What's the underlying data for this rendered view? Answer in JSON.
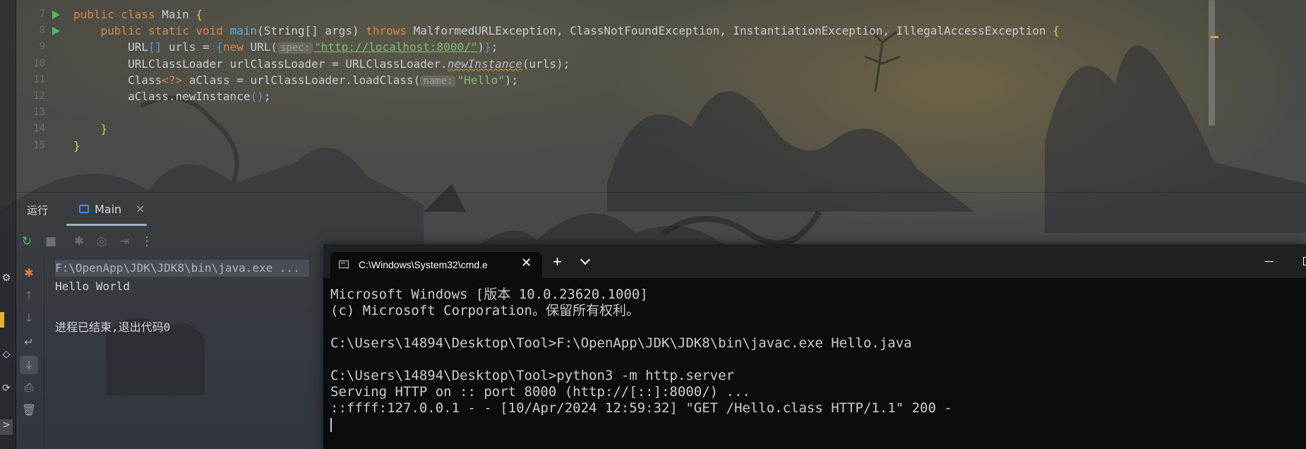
{
  "editor": {
    "lines": [
      {
        "num": "7",
        "run": true,
        "parts": [
          [
            "kw",
            "public class "
          ],
          [
            "br",
            "Main "
          ],
          [
            "br2",
            "{"
          ]
        ]
      },
      {
        "num": "8",
        "run": true,
        "parts": [
          [
            "kw",
            "    public static void "
          ],
          [
            "fn",
            "main"
          ],
          [
            "br",
            "(String[] args) "
          ],
          [
            "kw",
            "throws "
          ],
          [
            "br",
            "MalformedURLException, ClassNotFoundException, InstantiationException, IllegalAccessException "
          ],
          [
            "br2",
            "{"
          ]
        ]
      },
      {
        "num": "9",
        "run": false,
        "parts": [
          [
            "br",
            "        URL"
          ],
          [
            "br3",
            "[]"
          ],
          [
            "br",
            " urls = "
          ],
          [
            "br3",
            "{"
          ],
          [
            "kw",
            "new "
          ],
          [
            "br",
            "URL("
          ],
          [
            "hint",
            "spec:"
          ],
          [
            "str-link",
            "\"http://localhost:8000/\""
          ],
          [
            "br",
            ")"
          ],
          [
            "br3",
            "}"
          ],
          [
            "br",
            ";"
          ]
        ]
      },
      {
        "num": "10",
        "run": false,
        "parts": [
          [
            "br",
            "        URLClassLoader urlClassLoader = URLClassLoader."
          ],
          [
            "it",
            "newInstance"
          ],
          [
            "br",
            "(urls);"
          ]
        ]
      },
      {
        "num": "11",
        "run": false,
        "parts": [
          [
            "br",
            "        Class"
          ],
          [
            "kw",
            "<?>"
          ],
          [
            "br",
            " aClass = urlClassLoader.loadClass("
          ],
          [
            "hint",
            "name:"
          ],
          [
            "str",
            "\"Hello\""
          ],
          [
            "br",
            ");"
          ]
        ]
      },
      {
        "num": "12",
        "run": false,
        "parts": [
          [
            "br",
            "        aClass.newInstance"
          ],
          [
            "br3",
            "()"
          ],
          [
            "br",
            ";"
          ]
        ]
      },
      {
        "num": "13",
        "run": false,
        "parts": []
      },
      {
        "num": "14",
        "run": false,
        "parts": [
          [
            "br2",
            "    }"
          ]
        ]
      },
      {
        "num": "15",
        "run": false,
        "parts": [
          [
            "br2",
            "}"
          ]
        ]
      }
    ]
  },
  "run_panel": {
    "label": "运行",
    "tab_title": "Main",
    "tab_close": "×",
    "console": {
      "command": "F:\\OpenApp\\JDK\\JDK8\\bin\\java.exe ...",
      "output": "Hello World",
      "exit": "进程已结束,退出代码0"
    }
  },
  "icons": {
    "rerun": "↻",
    "stop": "■",
    "debug": "✱",
    "camera": "◎",
    "exit": "⇥",
    "more": "⋮",
    "up": "↑",
    "down": "↓",
    "wrap": "↵",
    "scroll_end": "⤓",
    "print": "⎙",
    "trash": "🗑"
  },
  "cmd": {
    "tab_title": "C:\\Windows\\System32\\cmd.e",
    "tab_close": "✕",
    "new_tab": "+",
    "lines": [
      "Microsoft Windows [版本 10.0.23620.1000]",
      "(c) Microsoft Corporation。保留所有权利。",
      "",
      "C:\\Users\\14894\\Desktop\\Tool>F:\\OpenApp\\JDK\\JDK8\\bin\\javac.exe Hello.java",
      "",
      "C:\\Users\\14894\\Desktop\\Tool>python3 -m http.server",
      "Serving HTTP on :: port 8000 (http://[::]:8000/) ...",
      "::ffff:127.0.0.1 - - [10/Apr/2024 12:59:32] \"GET /Hello.class HTTP/1.1\" 200 -"
    ]
  }
}
